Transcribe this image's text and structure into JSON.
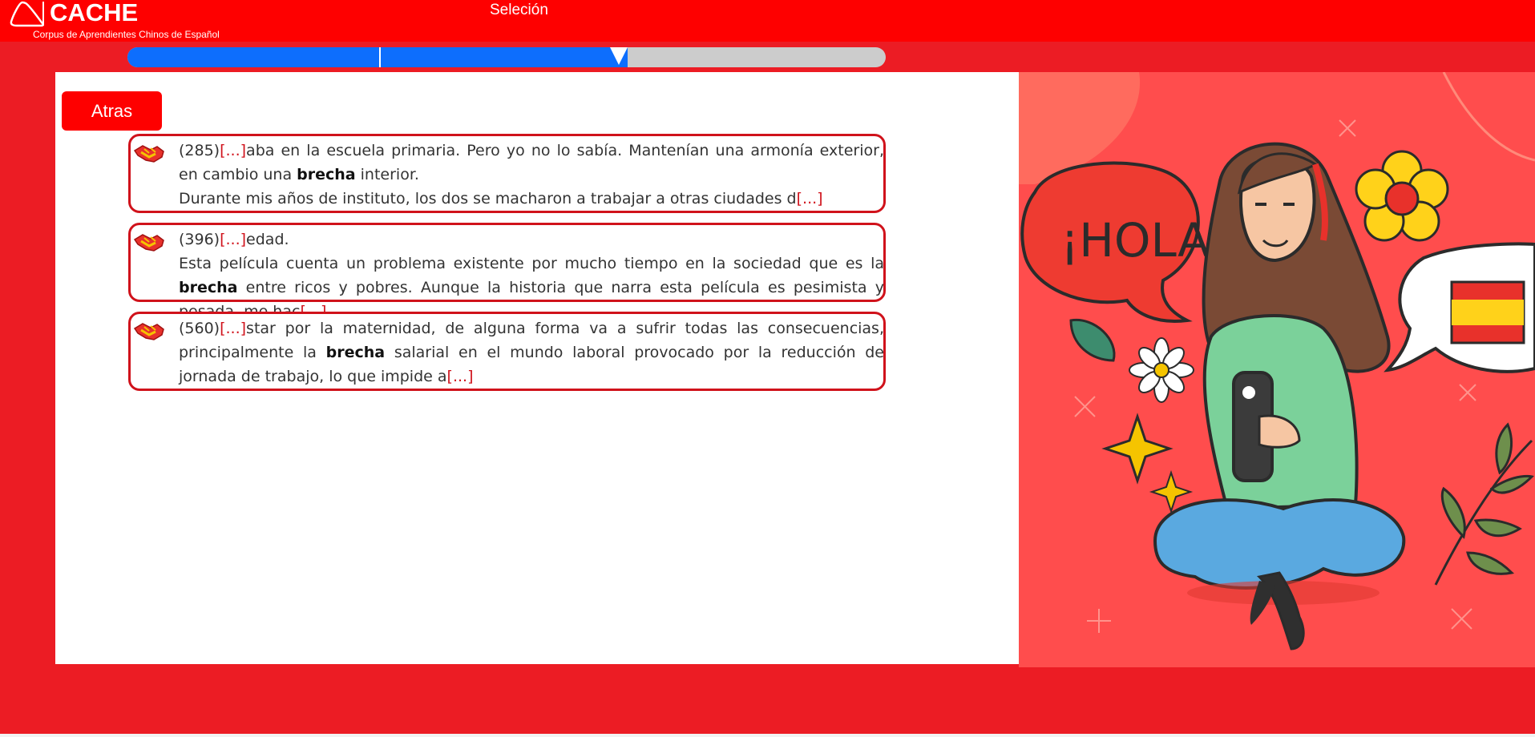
{
  "brand": {
    "name": "CACHE",
    "subtitle": "Corpus de Aprendientes Chinos de Español"
  },
  "page": {
    "title": "Seleción"
  },
  "progress": {
    "filled_fraction": 0.66
  },
  "actions": {
    "back_label": "Atras"
  },
  "results": [
    {
      "number": "(285)",
      "lines": [
        {
          "ellipsis_before": "[...]",
          "pre": "aba en la escuela primaria. Pero yo no lo sabía. Mantenían una armonía exterior, en cambio una ",
          "keyword": "brecha",
          "post": " interior.",
          "ellipsis_after": ""
        },
        {
          "ellipsis_before": "",
          "pre": "Durante mis años de instituto, los dos se macharon a trabajar a otras ciudades d",
          "keyword": "",
          "post": "",
          "ellipsis_after": "[...]"
        }
      ]
    },
    {
      "number": "(396)",
      "lines": [
        {
          "ellipsis_before": "[...]",
          "pre": "edad.",
          "keyword": "",
          "post": "",
          "ellipsis_after": ""
        },
        {
          "ellipsis_before": "",
          "pre": "Esta película cuenta un problema existente por mucho tiempo en la sociedad que es la ",
          "keyword": "brecha",
          "post": " entre ricos y pobres. Aunque la historia que narra esta película es pesimista y pesada, me hac",
          "ellipsis_after": "[...]"
        }
      ]
    },
    {
      "number": "(560)",
      "lines": [
        {
          "ellipsis_before": "[...]",
          "pre": "star por la maternidad, de alguna forma va a sufrir todas las consecuencias, principalmente la ",
          "keyword": "brecha",
          "post": " salarial en el mundo laboral provocado por la reducción de jornada de trabajo, lo que impide a",
          "ellipsis_after": "[...]"
        }
      ]
    }
  ],
  "illustration": {
    "speech_text": "¡HOLA!"
  },
  "colors": {
    "header_red": "#fe0000",
    "band_red": "#ec1c24",
    "card_border": "#d0121b",
    "progress_blue": "#0d6efd",
    "progress_track": "#cccccc",
    "illustration_bg": "#ff4d4d"
  }
}
